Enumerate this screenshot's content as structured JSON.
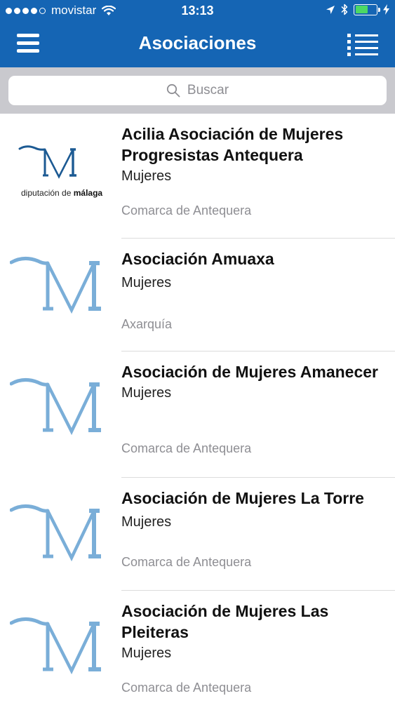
{
  "status_bar": {
    "carrier": "movistar",
    "time": "13:13",
    "signal_filled": 4,
    "signal_total": 5,
    "battery_level": 0.6,
    "battery_color": "#4cd964",
    "icons": [
      "wifi-icon",
      "location-arrow-icon",
      "bluetooth-icon",
      "battery-icon",
      "charging-bolt-icon"
    ]
  },
  "nav": {
    "title": "Asociaciones",
    "left_icon": "hamburger-menu-icon",
    "right_icon": "list-view-icon",
    "bar_color": "#1565b4"
  },
  "search": {
    "placeholder": "Buscar",
    "icon": "search-icon"
  },
  "items": [
    {
      "name": "Acilia Asociación de Mujeres Progresistas Antequera",
      "category": "Mujeres",
      "region": "Comarca de Antequera",
      "logo": "diputacion-malaga-logo",
      "logo_caption_pre": "diputación de ",
      "logo_caption_bold": "málaga"
    },
    {
      "name": "Asociación Amuaxa",
      "category": "Mujeres",
      "region": "Axarquía",
      "logo": "m-placeholder-logo"
    },
    {
      "name": "Asociación de Mujeres Amanecer",
      "category": "Mujeres",
      "region": "Comarca de Antequera",
      "logo": "m-placeholder-logo"
    },
    {
      "name": "Asociación de Mujeres La Torre",
      "category": "Mujeres",
      "region": "Comarca de Antequera",
      "logo": "m-placeholder-logo"
    },
    {
      "name": "Asociación de Mujeres Las Pleiteras",
      "category": "Mujeres",
      "region": "Comarca de Antequera",
      "logo": "m-placeholder-logo"
    }
  ]
}
